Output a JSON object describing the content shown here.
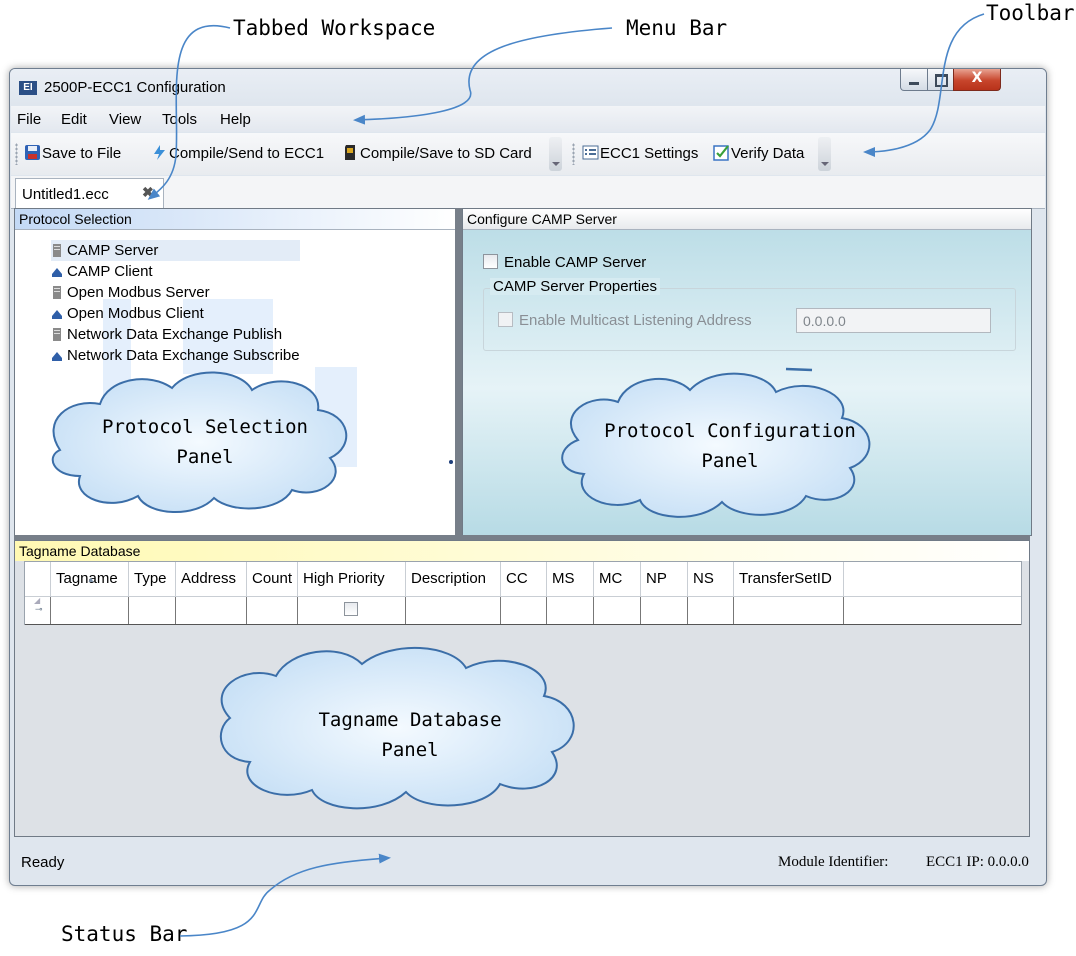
{
  "callouts": {
    "tabbed_workspace": "Tabbed Workspace",
    "menu_bar": "Menu Bar",
    "toolbar": "Toolbar",
    "status_bar": "Status Bar"
  },
  "window": {
    "title": "2500P-ECC1 Configuration",
    "app_icon_text": "EI",
    "close_glyph": "X"
  },
  "menu": {
    "items": [
      "File",
      "Edit",
      "View",
      "Tools",
      "Help"
    ]
  },
  "toolbar": {
    "save_to_file": "Save to File",
    "compile_send": "Compile/Send to ECC1",
    "compile_save_sd": "Compile/Save to SD Card",
    "ecc1_settings": "ECC1 Settings",
    "verify_data": "Verify Data"
  },
  "tabs": {
    "active": "Untitled1.ecc",
    "close_glyph": "✖"
  },
  "protocol_panel": {
    "header": "Protocol Selection",
    "items": [
      {
        "label": "CAMP Server",
        "icon": "server-icon"
      },
      {
        "label": "CAMP Client",
        "icon": "client-icon"
      },
      {
        "label": "Open Modbus Server",
        "icon": "server-icon"
      },
      {
        "label": "Open Modbus Client",
        "icon": "client-icon"
      },
      {
        "label": "Network Data Exchange Publish",
        "icon": "server-icon"
      },
      {
        "label": "Network Data Exchange Subscribe",
        "icon": "client-icon"
      }
    ],
    "cloud_label_line1": "Protocol Selection",
    "cloud_label_line2": "Panel"
  },
  "config_panel": {
    "header": "Configure CAMP Server",
    "enable_label": "Enable CAMP Server",
    "group_title": "CAMP Server Properties",
    "multicast_label": "Enable Multicast Listening Address",
    "multicast_address": "0.0.0.0",
    "cloud_label_line1": "Protocol Configuration",
    "cloud_label_line2": "Panel"
  },
  "tagname_panel": {
    "header": "Tagname Database",
    "columns": [
      "Tagname",
      "Type",
      "Address",
      "Count",
      "High Priority",
      "Description",
      "CC",
      "MS",
      "MC",
      "NP",
      "NS",
      "TransferSetID"
    ],
    "cloud_label_line1": "Tagname Database",
    "cloud_label_line2": "Panel"
  },
  "status": {
    "ready": "Ready",
    "module_identifier": "Module Identifier:",
    "ecc1_ip": "ECC1 IP: 0.0.0.0"
  },
  "colors": {
    "arrow": "#4a86c8",
    "cloud_fill": "#d4e8f8",
    "cloud_stroke": "#3b6ea8",
    "window_bg": "#dfe6ee",
    "close_button": "#c7452c"
  }
}
